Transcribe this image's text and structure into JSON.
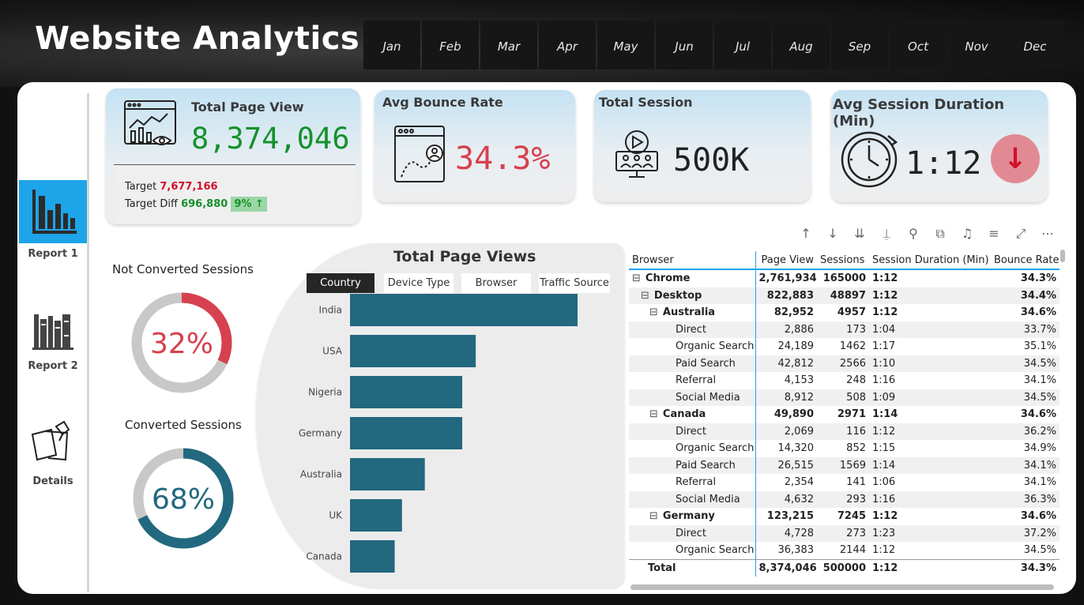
{
  "header": {
    "title": "Website Analytics",
    "months": [
      "Jan",
      "Feb",
      "Mar",
      "Apr",
      "May",
      "Jun",
      "Jul",
      "Aug",
      "Sep",
      "Oct",
      "Nov",
      "Dec"
    ]
  },
  "sidebar": {
    "items": [
      {
        "label": "Report 1",
        "icon": "bar-chart-icon"
      },
      {
        "label": "Report 2",
        "icon": "books-icon"
      },
      {
        "label": "Details",
        "icon": "notes-icon"
      }
    ]
  },
  "kpis": {
    "total_page_view": {
      "title": "Total Page View",
      "value": "8,374,046",
      "target_label": "Target",
      "target": "7,677,166",
      "diff_label": "Target Diff",
      "diff": "696,880",
      "diff_pct": "9%",
      "arrow": "↑"
    },
    "bounce": {
      "title": "Avg Bounce Rate",
      "value": "34.3%"
    },
    "session": {
      "title": "Total Session",
      "value": "500K"
    },
    "duration": {
      "title": "Avg Session Duration (Min)",
      "value": "1:12",
      "arrow": "↓"
    }
  },
  "colors": {
    "accent_blue": "#1ea4e9",
    "teal": "#22687f",
    "red": "#d7404f",
    "green": "#15912b",
    "ring_gray": "#c8c8c8"
  },
  "donuts": [
    {
      "title": "Not Converted Sessions",
      "label": "32%",
      "percent": 32,
      "color": "#d7404f"
    },
    {
      "title": "Converted Sessions",
      "label": "68%",
      "percent": 68,
      "color": "#22687f"
    }
  ],
  "bars_title": "Total Page Views",
  "tabs": [
    "Country",
    "Device Type",
    "Browser",
    "Traffic Source"
  ],
  "chart_data": {
    "type": "bar",
    "title": "Total Page Views",
    "categories": [
      "India",
      "USA",
      "Nigeria",
      "Germany",
      "Australia",
      "UK",
      "Canada"
    ],
    "values": [
      2190000,
      1210000,
      1080000,
      1080000,
      720000,
      500000,
      430000
    ]
  },
  "toolbar_icons": [
    "arrow-up-icon",
    "arrow-down-icon",
    "double-arrow-down-icon",
    "expand-hierarchy-icon",
    "pin-icon",
    "copy-icon",
    "bell-icon",
    "filter-icon",
    "focus-mode-icon",
    "more-icon"
  ],
  "table": {
    "headers": [
      "Browser",
      "Page View",
      "Sessions",
      "Session Duration (Min)",
      "Bounce Rate"
    ],
    "rows": [
      {
        "toggle": "⊟",
        "level": 0,
        "bold": true,
        "name": "Chrome",
        "pv": "2,761,934",
        "s": "165000",
        "d": "1:12",
        "br": "34.3%"
      },
      {
        "toggle": "⊟",
        "level": 1,
        "bold": true,
        "name": "Desktop",
        "pv": "822,883",
        "s": "48897",
        "d": "1:12",
        "br": "34.4%"
      },
      {
        "toggle": "⊟",
        "level": 2,
        "bold": true,
        "name": "Australia",
        "pv": "82,952",
        "s": "4957",
        "d": "1:12",
        "br": "34.6%"
      },
      {
        "toggle": "",
        "level": 3,
        "bold": false,
        "name": "Direct",
        "pv": "2,886",
        "s": "173",
        "d": "1:04",
        "br": "33.7%"
      },
      {
        "toggle": "",
        "level": 3,
        "bold": false,
        "name": "Organic Search",
        "pv": "24,189",
        "s": "1462",
        "d": "1:17",
        "br": "35.1%"
      },
      {
        "toggle": "",
        "level": 3,
        "bold": false,
        "name": "Paid Search",
        "pv": "42,812",
        "s": "2566",
        "d": "1:10",
        "br": "34.5%"
      },
      {
        "toggle": "",
        "level": 3,
        "bold": false,
        "name": "Referral",
        "pv": "4,153",
        "s": "248",
        "d": "1:16",
        "br": "34.1%"
      },
      {
        "toggle": "",
        "level": 3,
        "bold": false,
        "name": "Social Media",
        "pv": "8,912",
        "s": "508",
        "d": "1:09",
        "br": "34.5%"
      },
      {
        "toggle": "⊟",
        "level": 2,
        "bold": true,
        "name": "Canada",
        "pv": "49,890",
        "s": "2971",
        "d": "1:14",
        "br": "34.6%"
      },
      {
        "toggle": "",
        "level": 3,
        "bold": false,
        "name": "Direct",
        "pv": "2,069",
        "s": "116",
        "d": "1:12",
        "br": "36.2%"
      },
      {
        "toggle": "",
        "level": 3,
        "bold": false,
        "name": "Organic Search",
        "pv": "14,320",
        "s": "852",
        "d": "1:15",
        "br": "34.9%"
      },
      {
        "toggle": "",
        "level": 3,
        "bold": false,
        "name": "Paid Search",
        "pv": "26,515",
        "s": "1569",
        "d": "1:14",
        "br": "34.1%"
      },
      {
        "toggle": "",
        "level": 3,
        "bold": false,
        "name": "Referral",
        "pv": "2,354",
        "s": "141",
        "d": "1:06",
        "br": "34.1%"
      },
      {
        "toggle": "",
        "level": 3,
        "bold": false,
        "name": "Social Media",
        "pv": "4,632",
        "s": "293",
        "d": "1:16",
        "br": "36.3%"
      },
      {
        "toggle": "⊟",
        "level": 2,
        "bold": true,
        "name": "Germany",
        "pv": "123,215",
        "s": "7245",
        "d": "1:12",
        "br": "34.6%"
      },
      {
        "toggle": "",
        "level": 3,
        "bold": false,
        "name": "Direct",
        "pv": "4,728",
        "s": "273",
        "d": "1:23",
        "br": "37.2%"
      },
      {
        "toggle": "",
        "level": 3,
        "bold": false,
        "name": "Organic Search",
        "pv": "36,383",
        "s": "2144",
        "d": "1:12",
        "br": "34.5%"
      }
    ],
    "total": {
      "name": "Total",
      "pv": "8,374,046",
      "s": "500000",
      "d": "1:12",
      "br": "34.3%"
    }
  }
}
